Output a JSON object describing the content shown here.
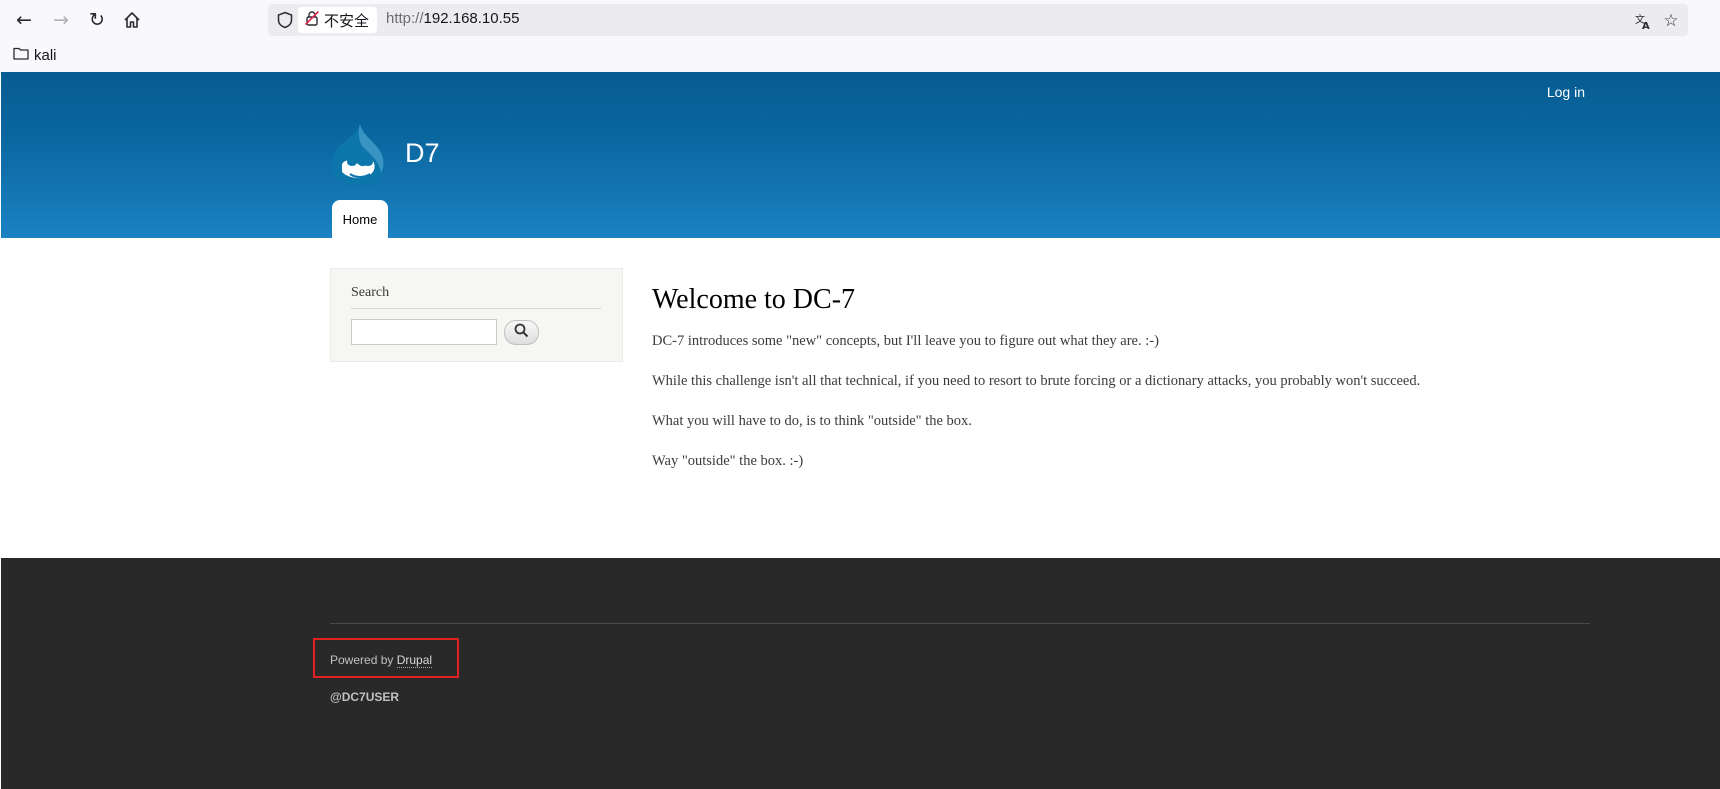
{
  "browser": {
    "security_label": "不安全",
    "url_protocol": "http://",
    "url_host": "192.168.10.55",
    "bookmark_folder": "kali",
    "icons": [
      "back-arrow-icon",
      "forward-arrow-icon",
      "reload-icon",
      "home-icon",
      "shield-icon",
      "insecure-lock-icon",
      "translate-icon",
      "star-icon",
      "folder-icon"
    ]
  },
  "header": {
    "login_label": "Log in",
    "site_name": "D7",
    "nav_tabs": [
      "Home"
    ],
    "brand_colors": {
      "header_top": "#065c91",
      "header_bottom": "#1b82c3"
    }
  },
  "sidebar": {
    "search_title": "Search",
    "search_value": ""
  },
  "content": {
    "title": "Welcome to DC-7",
    "paragraphs": [
      "DC-7 introduces some \"new\" concepts, but I'll leave you to figure out what they are.  :-)",
      "While this challenge isn't all that technical, if you need to resort to brute forcing or a dictionary attacks, you probably won't succeed.",
      "What you will have to do, is to think \"outside\" the box.",
      "Way \"outside\" the box.  :-)"
    ]
  },
  "footer": {
    "powered_prefix": "Powered by ",
    "powered_link": "Drupal",
    "twitter_handle": "@DC7USER",
    "highlight_color": "#e0211f"
  }
}
